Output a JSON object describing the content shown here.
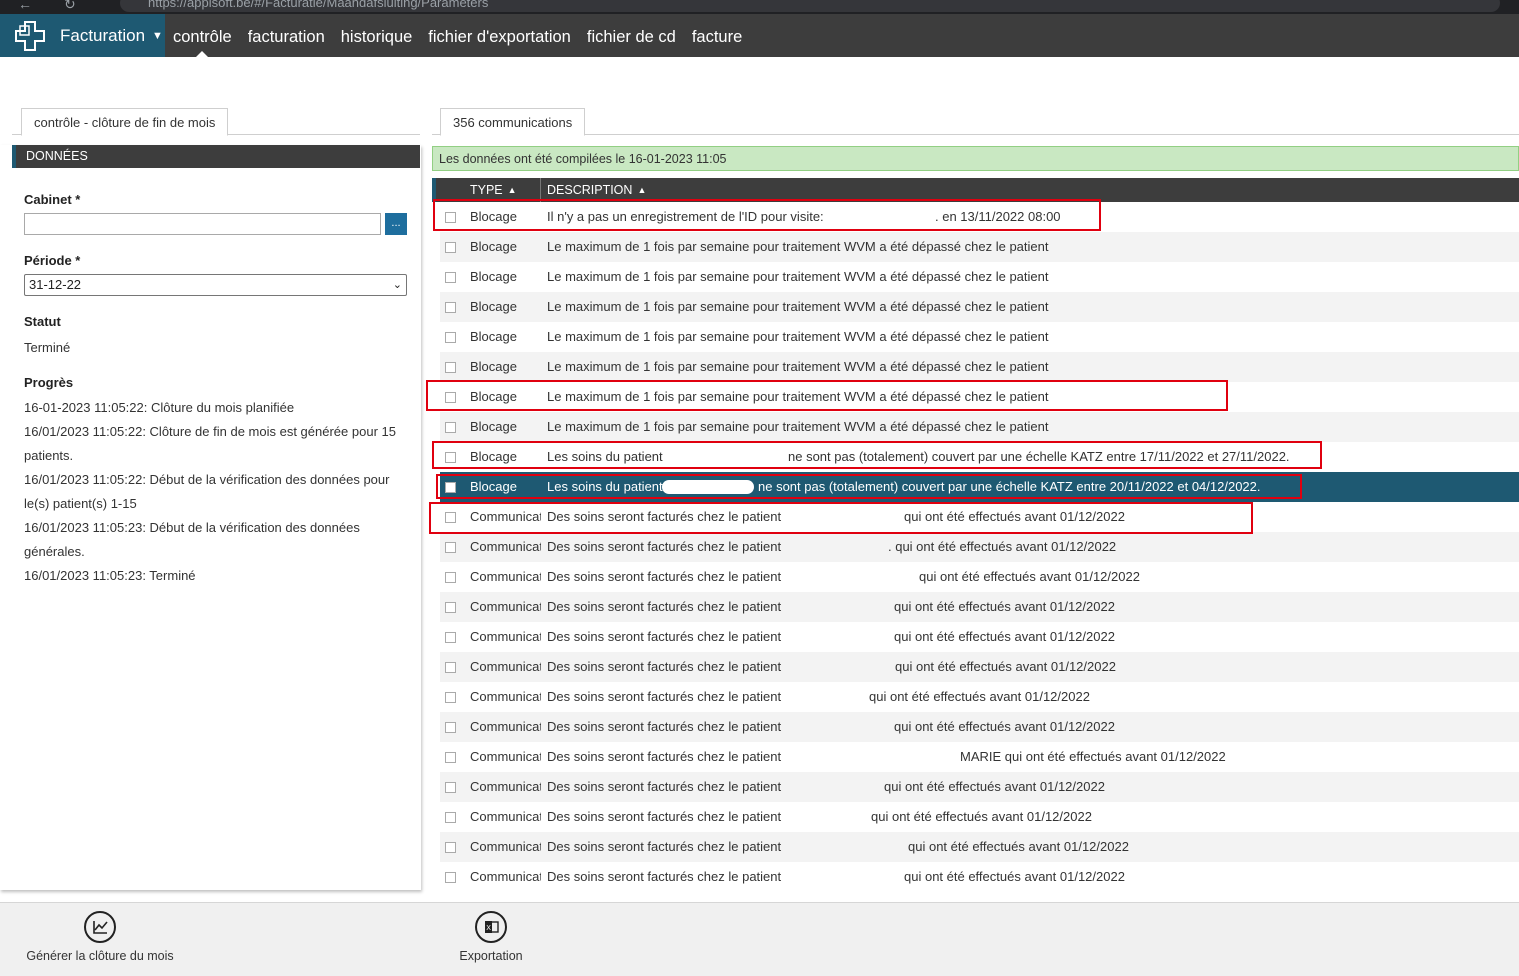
{
  "browser": {
    "url": "https://appisoft.be/#/Facturatie/Maandafsluiting/Parameters"
  },
  "header": {
    "brand": "Facturation",
    "nav": [
      "contrôle",
      "facturation",
      "historique",
      "fichier d'exportation",
      "fichier de cd",
      "facture"
    ],
    "active_nav": "contrôle"
  },
  "left": {
    "tab": "contrôle - clôture de fin de mois",
    "section": "DONNÉES",
    "cabinet_label": "Cabinet *",
    "cabinet_value": "",
    "cabinet_btn": "...",
    "period_label": "Période *",
    "period_value": "31-12-22",
    "status_label": "Statut",
    "status_value": "Terminé",
    "progress_label": "Progrès",
    "progress": [
      "16-01-2023 11:05:22: Clôture du mois planifiée",
      "16/01/2023 11:05:22: Clôture de fin de mois est générée pour  15 patients.",
      "16/01/2023 11:05:22: Début de la vérification des données pour le(s) patient(s)  1-15",
      "16/01/2023 11:05:23: Début de la vérification des données générales.",
      "16/01/2023 11:05:23: Terminé"
    ]
  },
  "right": {
    "tab": "356 communications",
    "alert": "Les données ont été compilées le 16-01-2023 11:05",
    "col_type": "TYPE",
    "col_desc": "DESCRIPTION",
    "rows": [
      {
        "type": "Blocage",
        "desc": "Il n'y a pas un enregistrement de l'ID pour visite:",
        "tail": ". en 13/11/2022 08:00"
      },
      {
        "type": "Blocage",
        "desc": "Le maximum de 1 fois par semaine pour traitement WVM a été dépassé chez le patient",
        "tail": ""
      },
      {
        "type": "Blocage",
        "desc": "Le maximum de 1 fois par semaine pour traitement WVM a été dépassé chez le patient",
        "tail": ""
      },
      {
        "type": "Blocage",
        "desc": "Le maximum de 1 fois par semaine pour traitement WVM a été dépassé chez le patient",
        "tail": ""
      },
      {
        "type": "Blocage",
        "desc": "Le maximum de 1 fois par semaine pour traitement WVM a été dépassé chez le patient",
        "tail": ""
      },
      {
        "type": "Blocage",
        "desc": "Le maximum de 1 fois par semaine pour traitement WVM a été dépassé chez le patient",
        "tail": ""
      },
      {
        "type": "Blocage",
        "desc": "Le maximum de 1 fois par semaine pour traitement WVM a été dépassé chez le patient",
        "tail": ""
      },
      {
        "type": "Blocage",
        "desc": "Le maximum de 1 fois par semaine pour traitement WVM a été dépassé chez le patient",
        "tail": ""
      },
      {
        "type": "Blocage",
        "desc": "Les soins du patient",
        "tail": "ne sont pas (totalement) couvert par une échelle KATZ entre 17/11/2022 et 27/11/2022."
      },
      {
        "type": "Blocage",
        "desc": "Les soins du patient",
        "tail": "ne sont pas (totalement) couvert par une échelle KATZ entre 20/11/2022 et 04/12/2022.",
        "selected": true
      },
      {
        "type": "Communication",
        "desc": "Des soins seront facturés chez le patient",
        "tail": "qui ont été effectués avant 01/12/2022"
      },
      {
        "type": "Communication",
        "desc": "Des soins seront facturés chez le patient",
        "tail": ". qui ont été effectués avant 01/12/2022"
      },
      {
        "type": "Communication",
        "desc": "Des soins seront facturés chez le patient",
        "tail": "qui ont été effectués avant 01/12/2022"
      },
      {
        "type": "Communication",
        "desc": "Des soins seront facturés chez le patient",
        "tail": "qui ont été effectués avant 01/12/2022"
      },
      {
        "type": "Communication",
        "desc": "Des soins seront facturés chez le patient",
        "tail": "qui ont été effectués avant 01/12/2022"
      },
      {
        "type": "Communication",
        "desc": "Des soins seront facturés chez le patient",
        "tail": "qui ont été effectués avant 01/12/2022"
      },
      {
        "type": "Communication",
        "desc": "Des soins seront facturés chez le patient",
        "tail": "qui ont été effectués avant 01/12/2022"
      },
      {
        "type": "Communication",
        "desc": "Des soins seront facturés chez le patient",
        "tail": "qui ont été effectués avant 01/12/2022"
      },
      {
        "type": "Communication",
        "desc": "Des soins seront facturés chez le patient",
        "tail": "MARIE qui ont été effectués avant 01/12/2022"
      },
      {
        "type": "Communication",
        "desc": "Des soins seront facturés chez le patient",
        "tail": "qui ont été effectués avant 01/12/2022"
      },
      {
        "type": "Communication",
        "desc": "Des soins seront facturés chez le patient",
        "tail": "qui ont été effectués avant 01/12/2022"
      },
      {
        "type": "Communication",
        "desc": "Des soins seront facturés chez le patient",
        "tail": "qui ont été effectués avant 01/12/2022"
      },
      {
        "type": "Communication",
        "desc": "Des soins seront facturés chez le patient",
        "tail": "qui ont été effectués avant 01/12/2022"
      }
    ]
  },
  "footer": {
    "generate_label": "Générer la clôture du mois",
    "export_label": "Exportation",
    "generate_icon": "chart-line-icon",
    "export_icon": "excel-icon"
  },
  "colors": {
    "brand": "#1e5972",
    "header": "#3d3d3d",
    "alert_bg": "#c9e8c2",
    "highlight": "#e0000f"
  }
}
